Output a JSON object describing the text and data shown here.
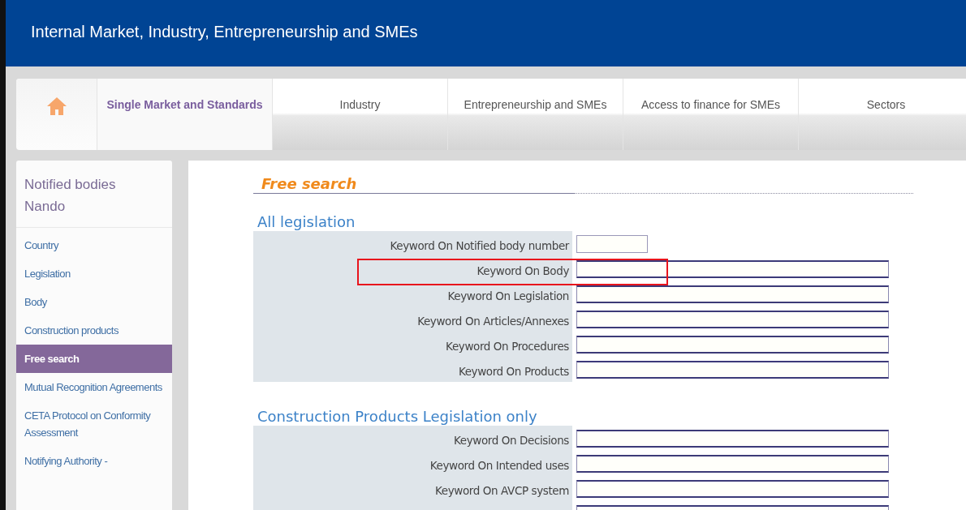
{
  "header": {
    "title": "Internal Market, Industry, Entrepreneurship and SMEs"
  },
  "nav": [
    {
      "kind": "home",
      "selected": false
    },
    {
      "kind": "text",
      "label": "Single Market and Standards",
      "selected": true
    },
    {
      "kind": "text",
      "label": "Industry",
      "selected": false
    },
    {
      "kind": "text",
      "label": "Entrepreneurship and SMEs",
      "selected": false
    },
    {
      "kind": "text",
      "label": "Access to finance for SMEs",
      "selected": false
    },
    {
      "kind": "text",
      "label": "Sectors",
      "selected": false
    }
  ],
  "sidebar": {
    "title": "Notified bodies Nando",
    "items": [
      {
        "label": "Country",
        "selected": false
      },
      {
        "label": "Legislation",
        "selected": false
      },
      {
        "label": "Body",
        "selected": false
      },
      {
        "label": "Construction products",
        "selected": false
      },
      {
        "label": "Free search",
        "selected": true
      },
      {
        "label": "Mutual Recognition Agreements",
        "selected": false
      },
      {
        "label": "CETA Protocol on Conformity Assessment",
        "selected": false
      },
      {
        "label": "Notifying Authority -",
        "selected": false
      }
    ]
  },
  "content": {
    "title": "Free search",
    "sections": [
      {
        "heading": "All legislation",
        "fields": [
          {
            "label": "Keyword On Notified body number",
            "kind": "short"
          },
          {
            "label": "Keyword On Body",
            "kind": "long"
          },
          {
            "label": "Keyword On Legislation",
            "kind": "long"
          },
          {
            "label": "Keyword On Articles/Annexes",
            "kind": "long"
          },
          {
            "label": "Keyword On Procedures",
            "kind": "long"
          },
          {
            "label": "Keyword On Products",
            "kind": "long"
          }
        ]
      },
      {
        "heading": "Construction Products Legislation only",
        "fields": [
          {
            "label": "Keyword On Decisions",
            "kind": "long"
          },
          {
            "label": "Keyword On Intended uses",
            "kind": "long"
          },
          {
            "label": "Keyword On AVCP system",
            "kind": "long"
          },
          {
            "kind": "long"
          }
        ]
      }
    ]
  }
}
